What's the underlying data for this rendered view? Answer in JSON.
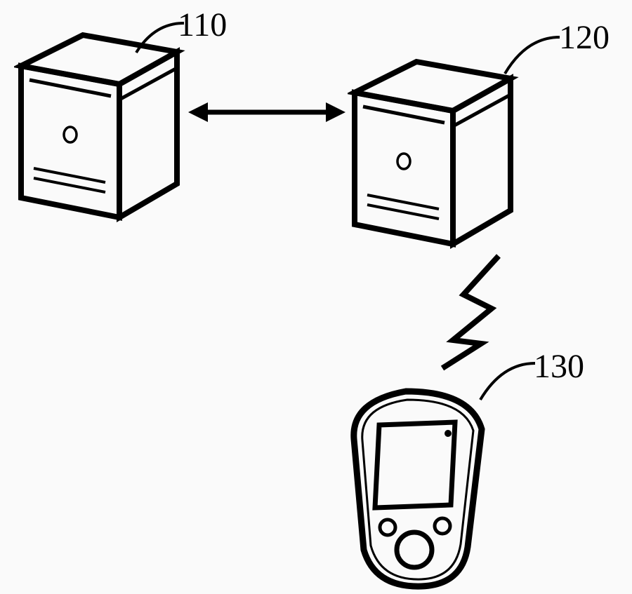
{
  "labels": {
    "server1": "110",
    "server2": "120",
    "device": "130"
  }
}
